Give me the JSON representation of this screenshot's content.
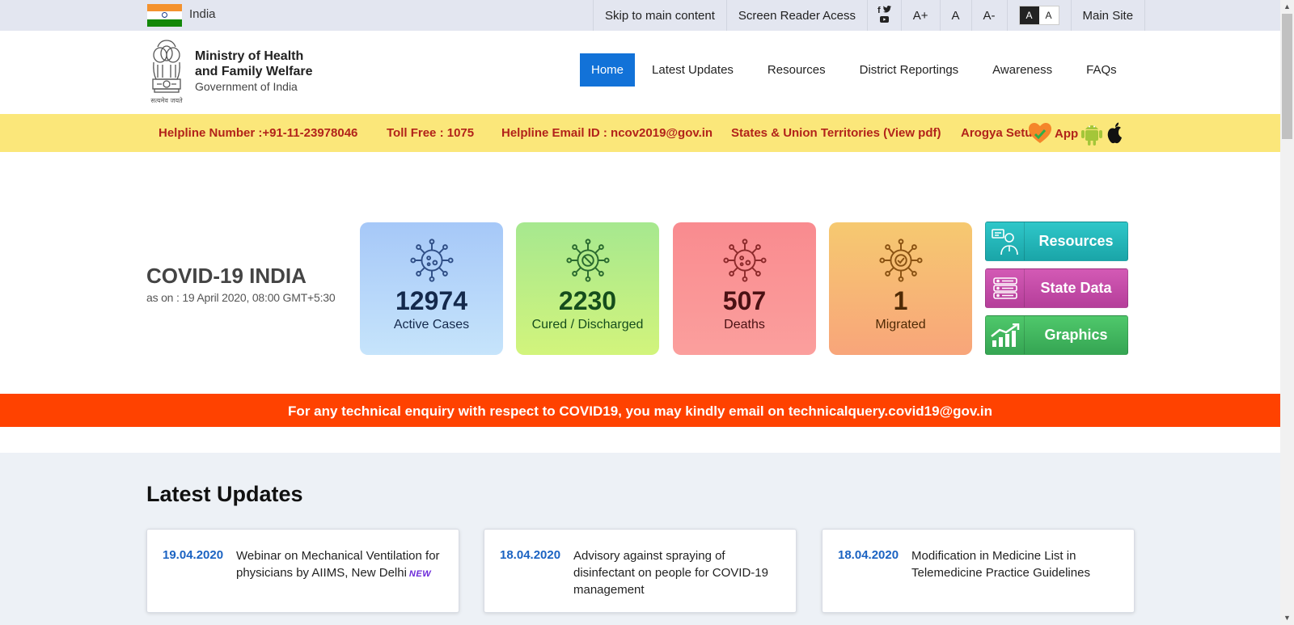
{
  "topbar": {
    "country": "India",
    "links": [
      "Skip to main content",
      "Screen Reader Acess"
    ],
    "social": {
      "facebook": "f",
      "twitter": "t",
      "youtube": "▶"
    },
    "font_sizes": [
      "A+",
      "A",
      "A-"
    ],
    "contrast": {
      "dark": "A",
      "light": "A"
    },
    "main_site": "Main Site"
  },
  "header": {
    "ministry_line1": "Ministry of Health",
    "ministry_line2": "and Family Welfare",
    "ministry_line3": "Government of India",
    "emblem_motto": "सत्यमेव जयते",
    "nav": [
      "Home",
      "Latest Updates",
      "Resources",
      "District Reportings",
      "Awareness",
      "FAQs"
    ]
  },
  "helpline": {
    "number": "Helpline Number :+91-11-23978046",
    "toll_free": "Toll Free : 1075",
    "email": "Helpline Email ID : ncov2019@gov.in",
    "states": "States & Union Territories (View pdf)",
    "arogya_label": "Arogya Setu",
    "app_label": "App"
  },
  "stats": {
    "title": "COVID-19 INDIA",
    "as_on": "as on : 19 April 2020, 08:00 GMT+5:30",
    "cards": [
      {
        "value": "12974",
        "label": "Active Cases"
      },
      {
        "value": "2230",
        "label": "Cured / Discharged"
      },
      {
        "value": "507",
        "label": "Deaths"
      },
      {
        "value": "1",
        "label": "Migrated"
      }
    ],
    "buttons": [
      "Resources",
      "State Data",
      "Graphics"
    ]
  },
  "tech_banner": "For any technical enquiry with respect to COVID19, you may kindly email on technicalquery.covid19@gov.in",
  "updates": {
    "heading": "Latest Updates",
    "items": [
      {
        "date": "19.04.2020",
        "text": "Webinar on Mechanical Ventilation for physicians by AIIMS, New Delhi",
        "badge": "NEW"
      },
      {
        "date": "18.04.2020",
        "text": "Advisory against spraying of disinfectant on people for COVID-19 management"
      },
      {
        "date": "18.04.2020",
        "text": "Modification in Medicine List in Telemedicine Practice Guidelines"
      }
    ]
  },
  "colors": {
    "topbar_bg": "#e3e6f0",
    "nav_active": "#1272d8",
    "helpline_bg": "#fbe77a",
    "helpline_text": "#b2231a",
    "tech_banner_bg": "#ff4200",
    "update_date": "#1b63c2"
  }
}
